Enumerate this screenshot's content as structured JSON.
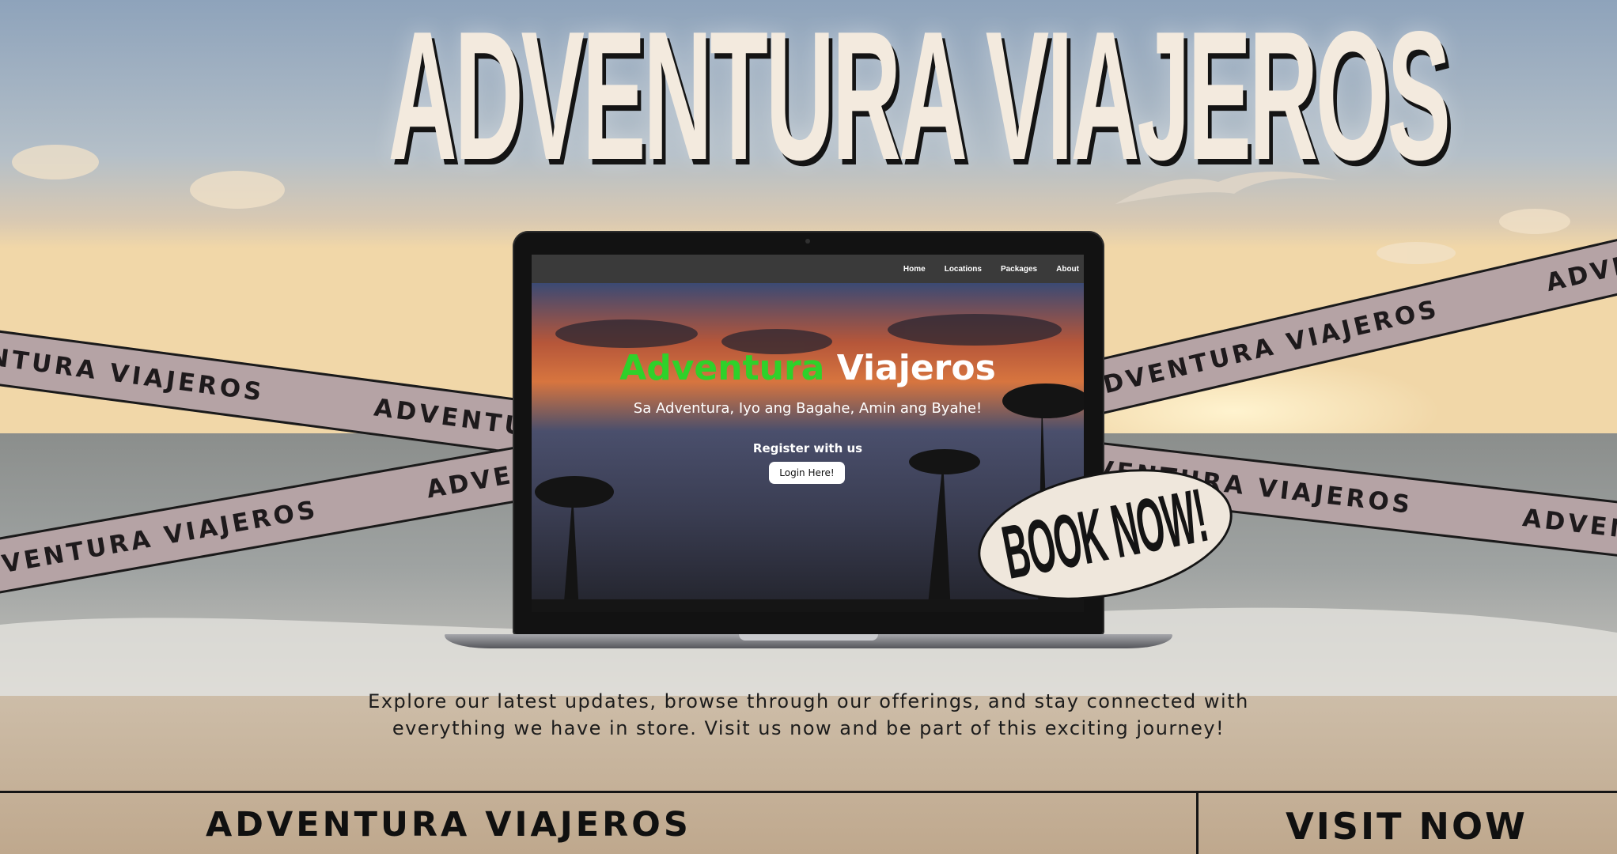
{
  "headline": "ADVENTURA VIAJEROS",
  "ribbons": {
    "top_left": "ADVENTURA VIAJEROS",
    "bottom_left": "ADVENTURA VIAJEROS",
    "top_right": "ADVENTURA VIAJEROS",
    "bottom_right": "ADVENTURA VIAJEROS"
  },
  "site_preview": {
    "nav": [
      "Home",
      "Locations",
      "Packages",
      "About"
    ],
    "title_part1": "Adventura",
    "title_part2": "Viajeros",
    "tagline": "Sa Adventura, Iyo ang Bagahe, Amin ang Byahe!",
    "register_text": "Register with us",
    "login_button": "Login Here!"
  },
  "sticker": "BOOK NOW!",
  "description": "Explore our latest updates, browse through our offerings, and stay connected with everything we have in store. Visit us now and be part of this exciting journey!",
  "footer": {
    "brand": "ADVENTURA VIAJEROS",
    "cta": "VISIT NOW"
  },
  "colors": {
    "title_green": "#2fd12a",
    "ribbon": "#b5a3a5",
    "cream": "#f3eade"
  }
}
